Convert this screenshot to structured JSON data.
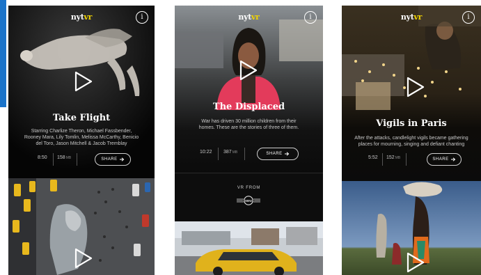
{
  "app": {
    "logo_prefix": "nyt",
    "logo_suffix": "vr"
  },
  "colors": {
    "logo_accent": "#f2d400",
    "side_accent": "#1a73c9",
    "background": "#0b0b0b"
  },
  "screens": [
    {
      "title": "Take Flight",
      "description": "Starring Charlize Theron, Michael Fassbender, Rooney Mara, Lily Tomlin, Melissa McCarthy, Benicio del Toro, Jason Mitchell & Jacob Tremblay",
      "stats": [
        {
          "value": "8:50",
          "unit": ""
        },
        {
          "value": "158",
          "unit": "MB"
        }
      ],
      "share_label": "SHARE",
      "icons": [
        "info-icon",
        "play-icon",
        "share-arrow-icon"
      ]
    },
    {
      "title": "The Displaced",
      "description": "War has driven 30 million children from their homes. These are the stories of three of them.",
      "stats": [
        {
          "value": "10:22",
          "unit": ""
        },
        {
          "value": "387",
          "unit": "MB"
        }
      ],
      "share_label": "SHARE",
      "sponsor_label": "VR FROM",
      "sponsor_brand": "MINI",
      "icons": [
        "info-icon",
        "play-icon",
        "share-arrow-icon",
        "mini-logo-icon"
      ]
    },
    {
      "title": "Vigils in Paris",
      "description": "After the attacks, candlelight vigils became gathering places for mourning, singing and defiant chanting",
      "stats": [
        {
          "value": "5:52",
          "unit": ""
        },
        {
          "value": "152",
          "unit": "MB"
        }
      ],
      "share_label": "SHARE",
      "icons": [
        "info-icon",
        "play-icon",
        "share-arrow-icon"
      ]
    }
  ]
}
